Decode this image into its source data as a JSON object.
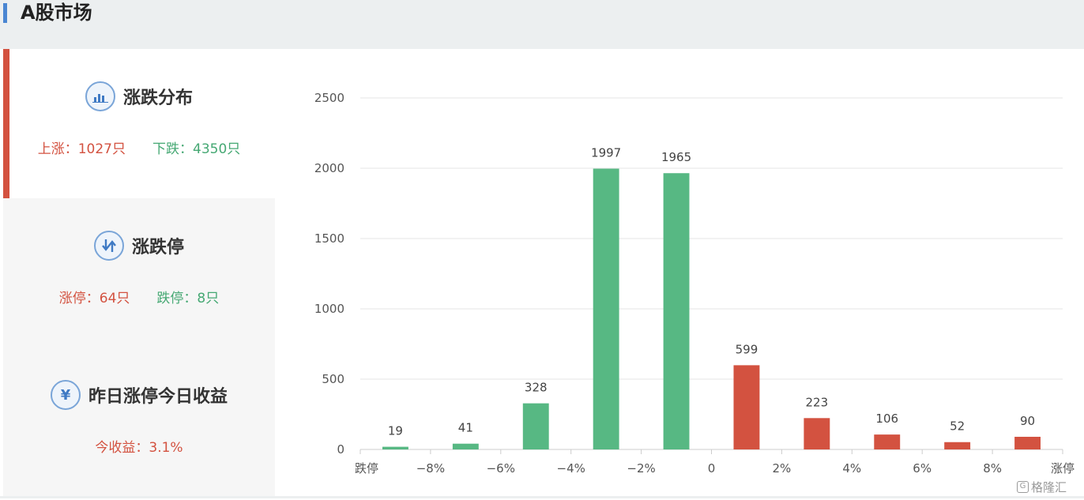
{
  "header": {
    "title": "A股市场"
  },
  "cards": {
    "distribution": {
      "title": "涨跌分布",
      "up": "上涨：1027只",
      "down": "下跌：4350只"
    },
    "limits": {
      "title": "涨跌停",
      "limit_up": "涨停：64只",
      "limit_down": "跌停：8只"
    },
    "yesterday": {
      "title": "昨日涨停今日收益",
      "icon_glyph": "¥",
      "return": "今收益：3.1%"
    }
  },
  "watermark": {
    "badge": "G",
    "text": "格隆汇"
  },
  "colors": {
    "up": "#d35240",
    "down": "#57b883",
    "accent": "#4a86d2"
  },
  "chart_data": {
    "type": "bar",
    "categories": [
      "跌停",
      "−8%",
      "−6%",
      "−4%",
      "−2%",
      "0",
      "2%",
      "4%",
      "6%",
      "8%",
      "涨停"
    ],
    "bars": [
      {
        "value": 19,
        "color": "down"
      },
      {
        "value": 41,
        "color": "down"
      },
      {
        "value": 328,
        "color": "down"
      },
      {
        "value": 1997,
        "color": "down"
      },
      {
        "value": 1965,
        "color": "down"
      },
      {
        "value": 599,
        "color": "up"
      },
      {
        "value": 223,
        "color": "up"
      },
      {
        "value": 106,
        "color": "up"
      },
      {
        "value": 52,
        "color": "up"
      },
      {
        "value": 90,
        "color": "up"
      }
    ],
    "yticks": [
      0,
      500,
      1000,
      1500,
      2000,
      2500
    ],
    "ylim": [
      0,
      2500
    ],
    "grid": true,
    "data_labels": true
  }
}
